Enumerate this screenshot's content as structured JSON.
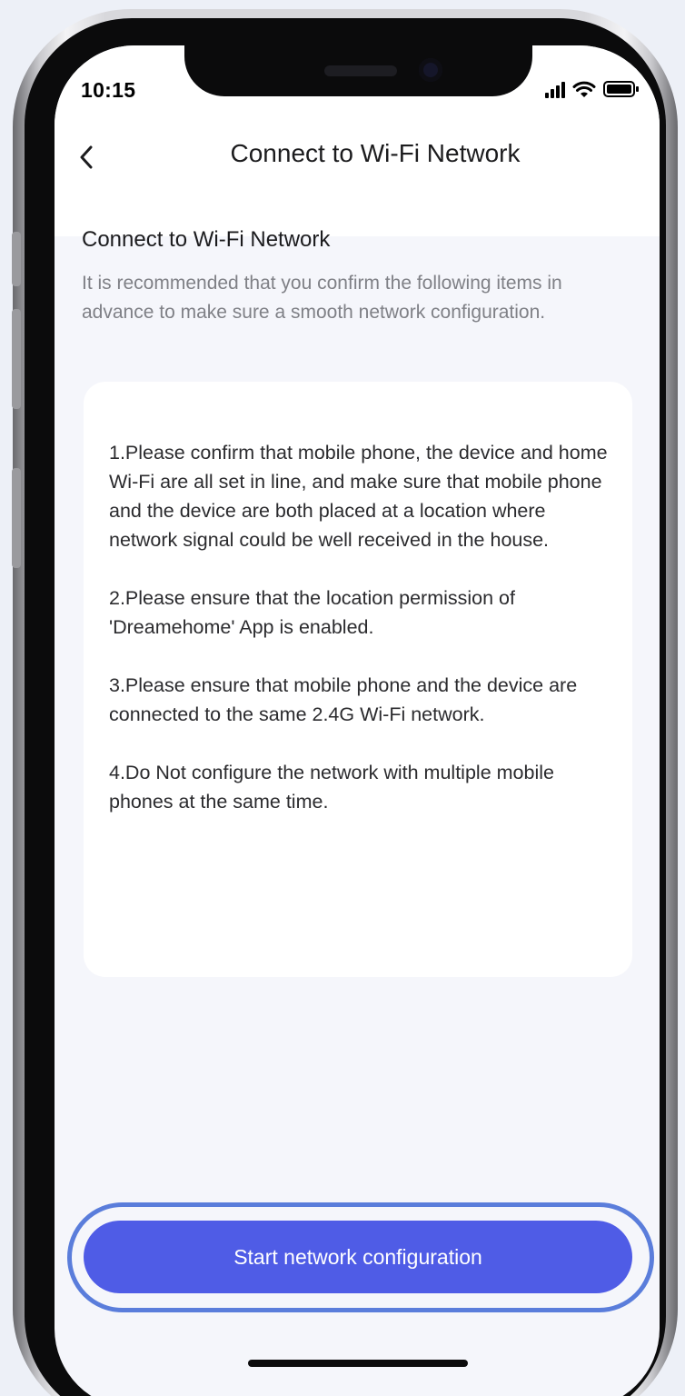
{
  "status_bar": {
    "time": "10:15"
  },
  "nav": {
    "title": "Connect to Wi-Fi Network"
  },
  "section": {
    "title": "Connect to Wi-Fi Network",
    "description": "It is recommended that you confirm the following items in advance to make sure a smooth network configuration."
  },
  "instructions": [
    "1.Please confirm that mobile phone, the device and home Wi-Fi are all set in line, and make sure that mobile phone and the device are both placed at a location where network signal could be well received in the house.",
    "2.Please ensure that the location permission of 'Dreamehome' App is enabled.",
    "3.Please ensure that mobile phone and the device are connected to the same 2.4G Wi-Fi network.",
    "4.Do Not configure the network with multiple mobile phones at the same time."
  ],
  "action": {
    "start_label": "Start network configuration"
  },
  "colors": {
    "accent": "#4f5ce6",
    "highlight_ring": "#5a7ddb",
    "background": "#f5f6fb"
  },
  "icons": {
    "back": "chevron-left-icon",
    "signal": "cellular-signal-icon",
    "wifi": "wifi-icon",
    "battery": "battery-icon"
  }
}
